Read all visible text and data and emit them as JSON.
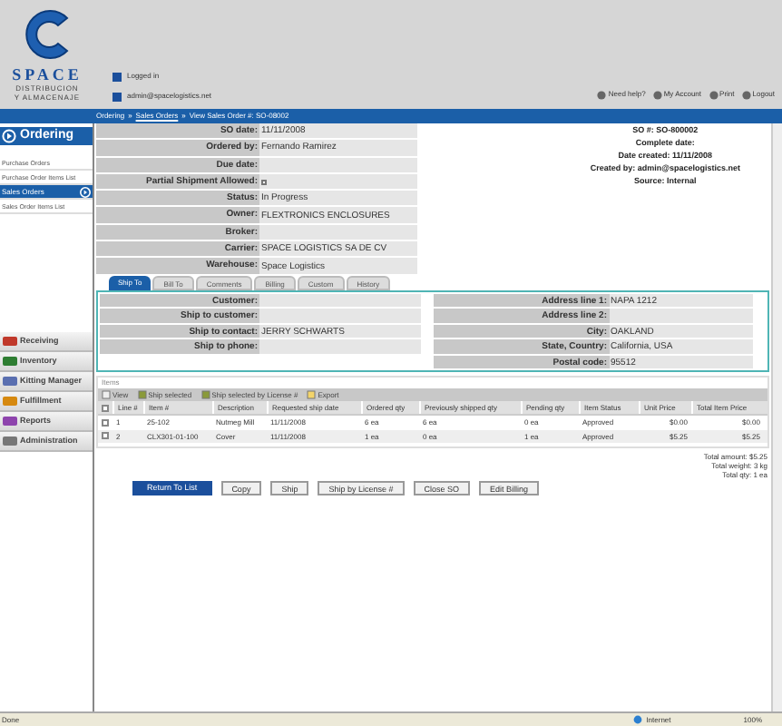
{
  "header": {
    "logo": {
      "name": "SPACE",
      "tagline": [
        "DISTRIBUCION",
        "Y ALMACENAJE"
      ]
    },
    "user": [
      "Logged in",
      "admin@spacelogistics.net"
    ],
    "links": [
      "Need help?",
      "My Account",
      "Print",
      "Logout"
    ]
  },
  "breadcrumb": {
    "separator": "»",
    "parts": [
      {
        "text": "Ordering",
        "link": false
      },
      {
        "text": "Sales Orders",
        "link": true
      },
      {
        "text": "View Sales Order #: SO-08002",
        "link": false
      }
    ]
  },
  "sidebar": {
    "section": "Ordering",
    "items": [
      {
        "label": "Purchase Orders",
        "selected": false
      },
      {
        "label": "Purchase Order Items List",
        "selected": false
      },
      {
        "label": "Sales Orders",
        "selected": true
      },
      {
        "label": "Sales Order Items List",
        "selected": false
      }
    ],
    "modules": [
      "Receiving",
      "Inventory",
      "Kitting Manager",
      "Fulfillment",
      "Reports",
      "Administration"
    ]
  },
  "order": {
    "fields": [
      {
        "label": "SO date:",
        "value": "11/11/2008"
      },
      {
        "label": "Ordered by:",
        "value": "Fernando Ramirez"
      },
      {
        "label": "Due date:"
      },
      {
        "label": "Partial Shipment Allowed:",
        "kind": "checkbox",
        "checked": false
      },
      {
        "label": "Status:",
        "value": "In Progress"
      },
      {
        "label": "Owner:",
        "value": "FLEXTRONICS ENCLOSURES"
      },
      {
        "label": "Broker:"
      },
      {
        "label": "Carrier:",
        "value": "SPACE LOGISTICS SA DE CV"
      },
      {
        "label": "Warehouse:",
        "value": "Space Logistics"
      }
    ],
    "info": [
      {
        "label": "SO #:",
        "value": "SO-800002"
      },
      {
        "label": "Complete date:"
      },
      {
        "label": "Date created:",
        "value": "11/11/2008"
      },
      {
        "label": "Created by:",
        "value": "admin@spacelogistics.net"
      },
      {
        "label": "Source:",
        "value": "Internal"
      }
    ]
  },
  "tabs": [
    {
      "label": "Ship To",
      "selected": true
    },
    {
      "label": "Bill To",
      "selected": false
    },
    {
      "label": "Comments",
      "selected": false
    },
    {
      "label": "Billing",
      "selected": false
    },
    {
      "label": "Custom",
      "selected": false
    },
    {
      "label": "History",
      "selected": false
    }
  ],
  "ship_to": {
    "left": [
      {
        "label": "Customer:"
      },
      {
        "label": "Ship to customer:"
      },
      {
        "label": "Ship to contact:",
        "value": "JERRY SCHWARTS"
      },
      {
        "label": "Ship to phone:"
      }
    ],
    "right": [
      {
        "label": "Address line 1:",
        "value": "NAPA 1212"
      },
      {
        "label": "Address line 2:"
      },
      {
        "label": "City:",
        "value": "OAKLAND"
      },
      {
        "label": "State, Country:",
        "value": "California, USA"
      },
      {
        "label": "Postal code:",
        "value": "95512"
      }
    ]
  },
  "items": {
    "legend": "Items",
    "select_all": {
      "checked": false
    },
    "toolbar": [
      "View",
      "Ship selected",
      "Ship selected by License #",
      "Export"
    ],
    "columns": [
      "Line #",
      "Item #",
      "Description",
      "Requested ship date",
      "Ordered qty",
      "Previously shipped qty",
      "Pending qty",
      "Item Status",
      "Unit Price",
      "Total Item Price"
    ],
    "rows": [
      {
        "checked": false,
        "cells": [
          "1",
          "25-102",
          "Nutmeg Mill",
          "11/11/2008",
          "6 ea",
          "6 ea",
          "0 ea",
          "Approved",
          "$0.00",
          "$0.00"
        ]
      },
      {
        "checked": false,
        "cells": [
          "2",
          "CLX301-01-100",
          "Cover",
          "11/11/2008",
          "1 ea",
          "0 ea",
          "1 ea",
          "Approved",
          "$5.25",
          "$5.25"
        ]
      }
    ],
    "totals": [
      "Total amount: $5.25",
      "Total weight: 3 kg",
      "Total qty: 1 ea"
    ]
  },
  "buttons": [
    {
      "label": "Return To List",
      "kind": "primary"
    },
    {
      "label": "Copy",
      "kind": "normal"
    },
    {
      "label": "Ship",
      "kind": "normal"
    },
    {
      "label": "Ship by License #",
      "kind": "normal"
    },
    {
      "label": "Close SO",
      "kind": "normal"
    },
    {
      "label": "Edit Billing",
      "kind": "normal"
    }
  ],
  "status_bar": {
    "text": "Done",
    "zone": "Internet",
    "zoom": "100%"
  }
}
